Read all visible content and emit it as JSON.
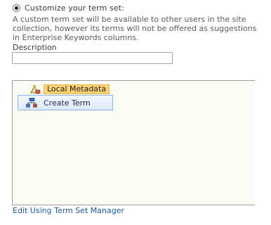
{
  "radio_option": {
    "label": "Customize your term set:",
    "selected": true
  },
  "description_text": "A custom term set will be available to other users in the site collection, however its terms will not be offered as suggestions in Enterprise Keywords columns.",
  "description_field": {
    "label": "Description",
    "value": ""
  },
  "term_tree": {
    "root": {
      "label": "Local Metadata",
      "icon": "term-set-icon"
    },
    "context_menu": {
      "items": [
        {
          "label": "Create Term",
          "icon": "create-term-icon"
        }
      ]
    }
  },
  "edit_link": {
    "label": "Edit Using Term Set Manager"
  },
  "colors": {
    "link": "#1a5bb0",
    "node_highlight": "#fbd373",
    "menu_border": "#8fb5e6"
  }
}
